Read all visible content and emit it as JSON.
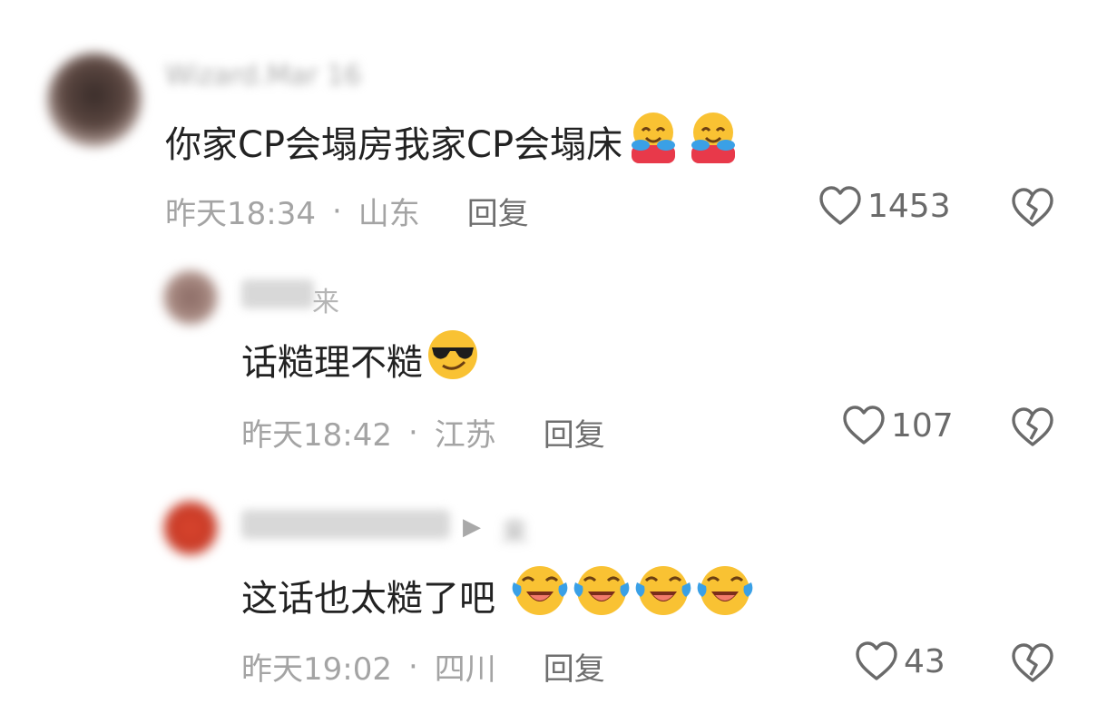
{
  "comments": [
    {
      "username": "Wizard.Mar 16",
      "text": "你家CP会塌房我家CP会塌床",
      "emojis": [
        "hugging-face-emoji",
        "hugging-face-emoji"
      ],
      "time": "昨天18:34",
      "location": "山东",
      "reply_label": "回复",
      "likes": "1453"
    },
    {
      "username": "来",
      "text": "话糙理不糙",
      "emojis": [
        "sunglasses-face-emoji"
      ],
      "time": "昨天18:42",
      "location": "江苏",
      "reply_label": "回复",
      "likes": "107"
    },
    {
      "username": "",
      "reply_to": "来",
      "text": "这话也太糙了吧",
      "emojis": [
        "crying-laughing-emoji",
        "crying-laughing-emoji",
        "crying-laughing-emoji",
        "crying-laughing-emoji"
      ],
      "time": "昨天19:02",
      "location": "四川",
      "reply_label": "回复",
      "likes": "43"
    }
  ],
  "separator": "·",
  "colors": {
    "text": "#222222",
    "meta": "#a4a4a4",
    "reply": "#6f6f6f",
    "icon": "#6a6a6a"
  }
}
